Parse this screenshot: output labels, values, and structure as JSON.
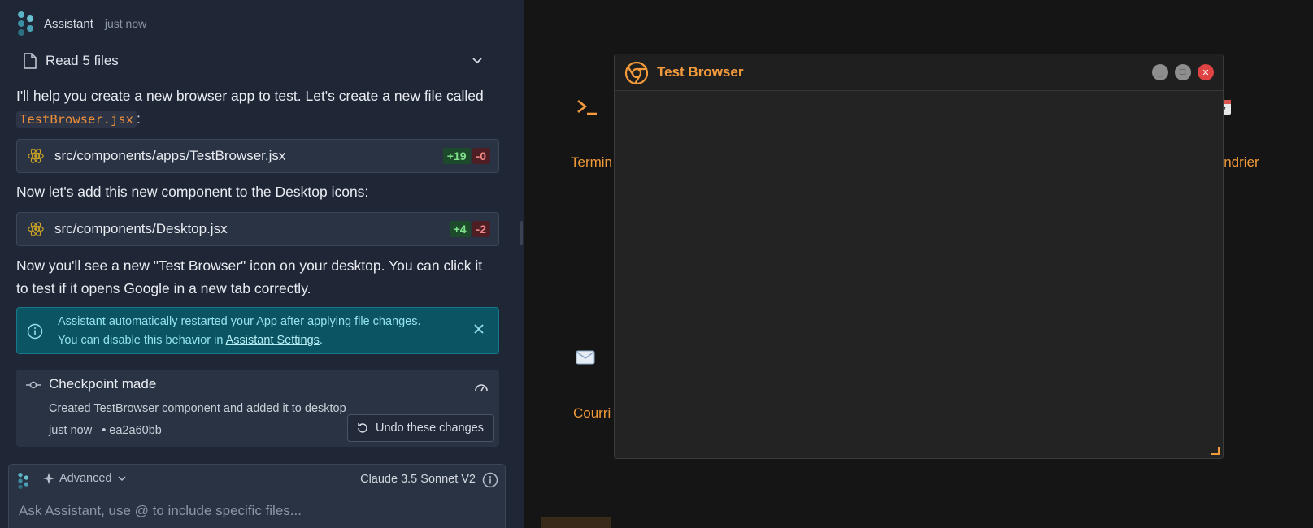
{
  "assistant": {
    "name": "Assistant",
    "time": "just now",
    "read_files": "Read 5 files",
    "intro_text": "I'll help you create a new browser app to test. Let's create a new file called",
    "intro_code": "TestBrowser.jsx",
    "intro_suffix": ":",
    "file1": {
      "path": "src/components/apps/TestBrowser.jsx",
      "added": "+19",
      "removed": "-0"
    },
    "middle_text": "Now let's add this new component to the Desktop icons:",
    "file2": {
      "path": "src/components/Desktop.jsx",
      "added": "+4",
      "removed": "-2"
    },
    "outro_text": "Now you'll see a new \"Test Browser\" icon on your desktop. You can click it to test if it opens Google in a new tab correctly.",
    "notice": {
      "line1": "Assistant automatically restarted your App after applying file changes.",
      "line2_prefix": "You can disable this behavior in ",
      "line2_link": "Assistant Settings",
      "line2_suffix": "."
    },
    "checkpoint": {
      "title": "Checkpoint made",
      "description": "Created TestBrowser component and added it to desktop",
      "time": "just now",
      "hash": "• ea2a60bb",
      "undo_label": "Undo these changes"
    },
    "composer": {
      "mode": "Advanced",
      "model": "Claude 3.5 Sonnet V2",
      "placeholder": "Ask Assistant, use @ to include specific files..."
    }
  },
  "desktop": {
    "icons": [
      {
        "label": "Termin",
        "icon": "terminal-icon"
      },
      {
        "label": "lendrier",
        "icon": "calendar-icon"
      },
      {
        "label": "Courri",
        "icon": "mail-icon"
      }
    ],
    "window": {
      "title": "Test Browser",
      "icon": "chrome-icon",
      "minimize": "_",
      "maximize": "□",
      "close": "✕"
    }
  },
  "colors": {
    "accent": "#f39a3c",
    "panel_bg": "#1f2737",
    "desktop_bg": "#151515",
    "notice_bg": "#0b5463"
  }
}
